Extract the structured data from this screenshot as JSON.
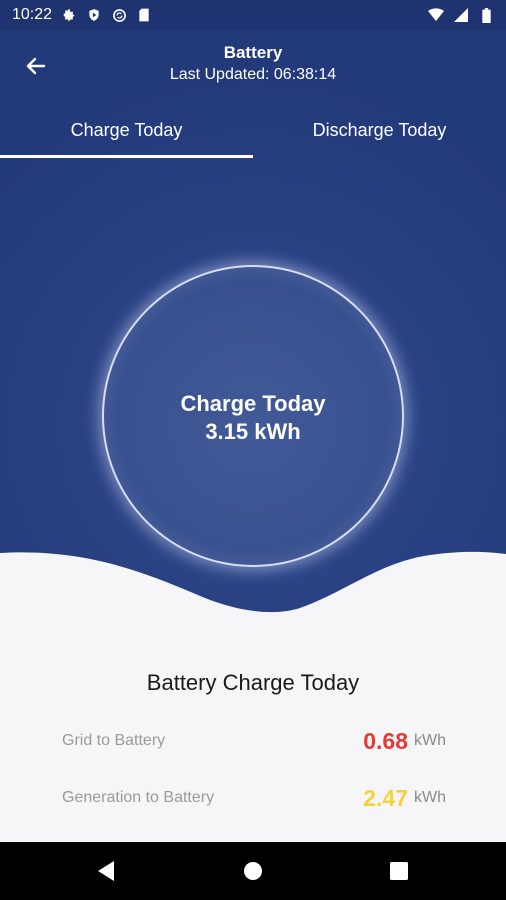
{
  "status_bar": {
    "time": "10:22",
    "left_icons": [
      "gear-icon",
      "shield-icon",
      "sync-icon",
      "sd-card-icon"
    ],
    "right_icons": [
      "wifi-icon",
      "signal-icon",
      "battery-icon"
    ]
  },
  "header": {
    "title": "Battery",
    "subtitle": "Last Updated: 06:38:14"
  },
  "tabs": [
    {
      "label": "Charge Today",
      "active": true
    },
    {
      "label": "Discharge Today",
      "active": false
    }
  ],
  "gauge": {
    "label": "Charge Today",
    "value": "3.15 kWh"
  },
  "summary": {
    "title": "Battery Charge Today",
    "rows": [
      {
        "label": "Grid to Battery",
        "value": "0.68",
        "unit": "kWh",
        "color": "#e53935"
      },
      {
        "label": "Generation to Battery",
        "value": "2.47",
        "unit": "kWh",
        "color": "#f5d23c"
      }
    ]
  },
  "colors": {
    "primary": "#22397a",
    "background": "#f6f6f8"
  }
}
